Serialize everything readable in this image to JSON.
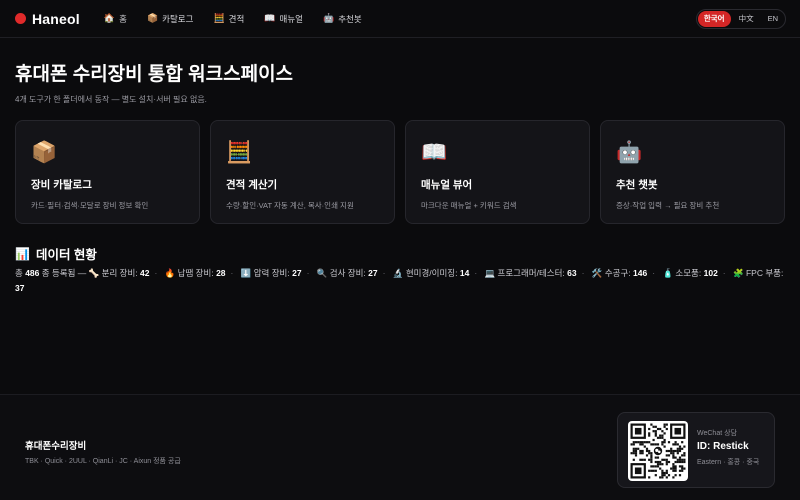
{
  "brand": {
    "name": "Haneol",
    "accent": "#e02a2a"
  },
  "nav": [
    {
      "icon": "🏠",
      "label": "홈"
    },
    {
      "icon": "📦",
      "label": "카탈로그"
    },
    {
      "icon": "🧮",
      "label": "견적"
    },
    {
      "icon": "📖",
      "label": "매뉴얼"
    },
    {
      "icon": "🤖",
      "label": "추천봇"
    }
  ],
  "languages": [
    {
      "label": "한국어",
      "active": true
    },
    {
      "label": "中文",
      "active": false
    },
    {
      "label": "EN",
      "active": false
    }
  ],
  "page": {
    "title": "휴대폰 수리장비 통합 워크스페이스",
    "subtitle": "4개 도구가 한 폴더에서 동작 — 별도 설치·서버 필요 없음."
  },
  "cards": [
    {
      "icon": "📦",
      "title": "장비 카탈로그",
      "desc": "카드·필터·검색·모달로 장비 정보 확인"
    },
    {
      "icon": "🧮",
      "title": "견적 계산기",
      "desc": "수량·할인·VAT 자동 계산, 복사·인쇄 지원"
    },
    {
      "icon": "📖",
      "title": "매뉴얼 뷰어",
      "desc": "마크다운 매뉴얼 + 키워드 검색"
    },
    {
      "icon": "🤖",
      "title": "추천 챗봇",
      "desc": "증상·작업 입력 → 필요 장비 추천"
    }
  ],
  "data_status": {
    "icon": "📊",
    "title": "데이터 현황",
    "total_prefix": "총",
    "total": "486",
    "total_suffix": "종 등록됨 —",
    "categories": [
      {
        "icon": "🦴",
        "label": "분리 장비:",
        "count": "42"
      },
      {
        "icon": "🔥",
        "label": "납땜 장비:",
        "count": "28"
      },
      {
        "icon": "⬇️",
        "label": "압력 장비:",
        "count": "27"
      },
      {
        "icon": "🔍",
        "label": "검사 장비:",
        "count": "27"
      },
      {
        "icon": "🔬",
        "label": "현미경/이미징:",
        "count": "14"
      },
      {
        "icon": "💻",
        "label": "프로그래머/테스터:",
        "count": "63"
      },
      {
        "icon": "🛠️",
        "label": "수공구:",
        "count": "146"
      },
      {
        "icon": "🧴",
        "label": "소모품:",
        "count": "102"
      },
      {
        "icon": "🧩",
        "label": "FPC 부품:",
        "count": "37"
      }
    ]
  },
  "footer": {
    "name": "휴대폰수리장비",
    "brands": "TBK · Quick · 2UUL · QianLi · JC · Aixun 정품 공급",
    "wechat": {
      "label": "WeChat 상담",
      "id": "ID: Restick",
      "location": "Eastern · 홍콩 · 중국"
    }
  }
}
